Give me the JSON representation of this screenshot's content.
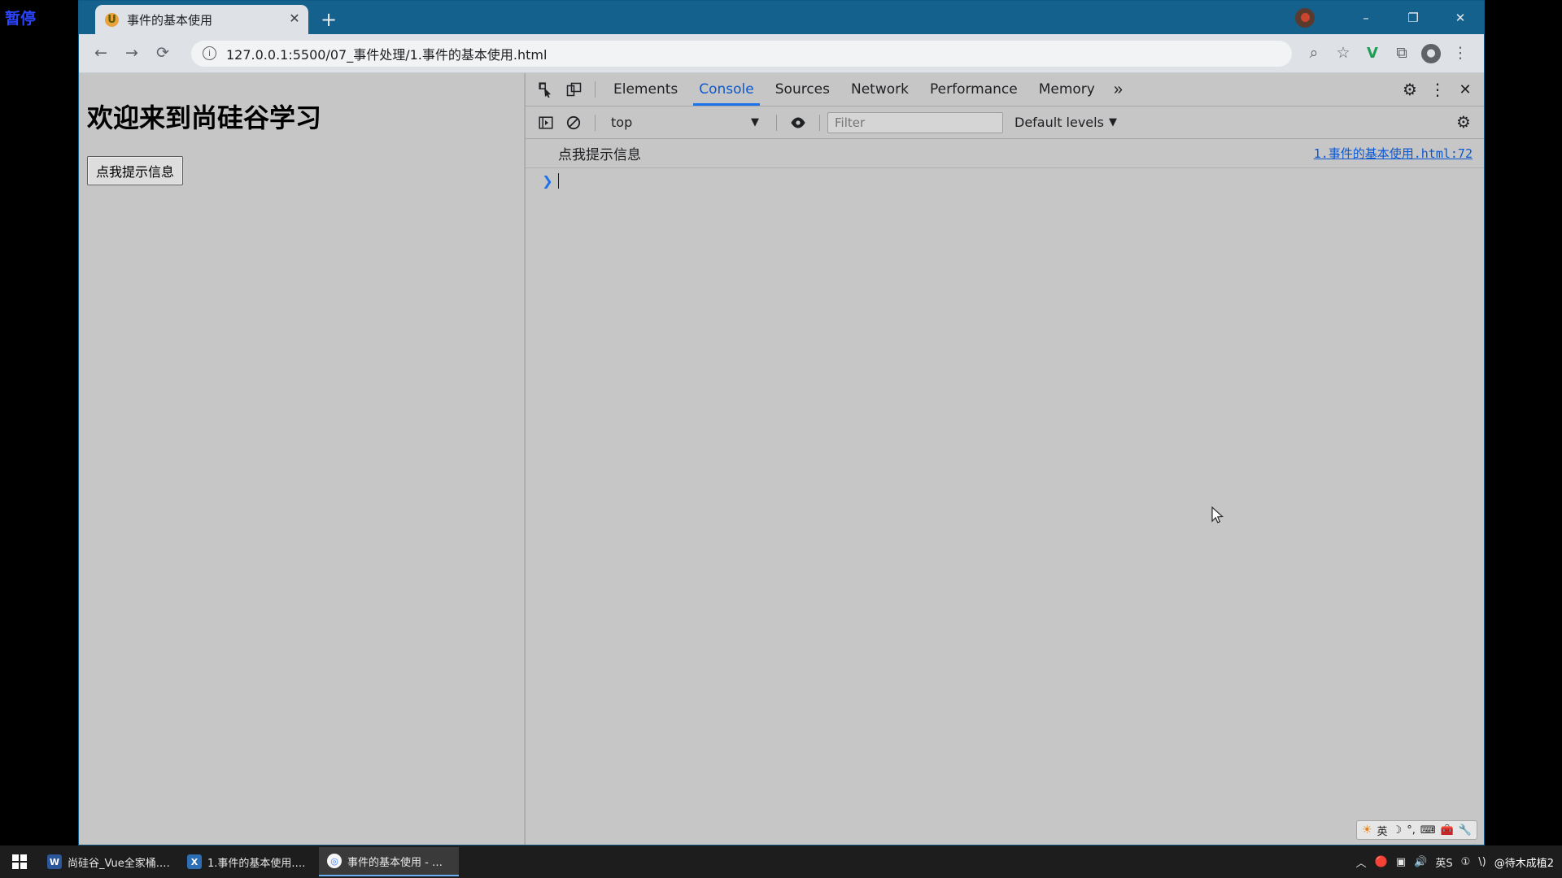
{
  "desktop": {
    "left_label": "暂停"
  },
  "browser": {
    "tab": {
      "title": "事件的基本使用",
      "favicon": "vue-favicon-icon",
      "close_label": "✕"
    },
    "new_tab_label": "+",
    "window_controls": {
      "minimize": "–",
      "maximize": "❐",
      "close": "✕"
    },
    "toolbar": {
      "back_label": "←",
      "forward_label": "→",
      "reload_label": "⟳",
      "url": "127.0.0.1:5500/07_事件处理/1.事件的基本使用.html",
      "info_label": "i",
      "zoom_label": "⌕",
      "bookmark_label": "☆",
      "ext_label": "V",
      "puzzle_label": "⧉",
      "avatar_label": "●",
      "menu_label": "⋮"
    }
  },
  "page": {
    "heading": "欢迎来到尚硅谷学习",
    "button_label": "点我提示信息"
  },
  "devtools": {
    "inspect_icon": "inspect-element-icon",
    "device_icon": "device-toolbar-icon",
    "tabs": [
      {
        "label": "Elements",
        "active": false
      },
      {
        "label": "Console",
        "active": true
      },
      {
        "label": "Sources",
        "active": false
      },
      {
        "label": "Network",
        "active": false
      },
      {
        "label": "Performance",
        "active": false
      },
      {
        "label": "Memory",
        "active": false
      }
    ],
    "more_tabs_label": "»",
    "settings_label": "⚙",
    "kebab_label": "⋮",
    "close_label": "✕",
    "console_toolbar": {
      "sidebar_label": "▶",
      "clear_label": "⊘",
      "context": "top",
      "context_caret": "▼",
      "eye_label": "◉",
      "filter_placeholder": "Filter",
      "filter_value": "",
      "levels_label": "Default levels",
      "levels_caret": "▼",
      "gear_label": "⚙"
    },
    "logs": [
      {
        "message": "点我提示信息",
        "source": "1.事件的基本使用.html:72"
      }
    ],
    "prompt": {
      "arrow": "❯",
      "value": ""
    },
    "ime_tray": {
      "logo": "搜狗输入法图标",
      "mode": "英",
      "moon": "☽",
      "punct": "°,",
      "keyboard": "⌨",
      "toolbox": "🧰",
      "wrench": "🔧"
    }
  },
  "taskbar": {
    "start_label": "start-icon",
    "items": [
      {
        "label": "尚硅谷_Vue全家桶.d...",
        "icon": "word-icon",
        "icon_text": "W",
        "active": false
      },
      {
        "label": "1.事件的基本使用.ht...",
        "icon": "vscode-icon",
        "icon_text": "X",
        "active": false
      },
      {
        "label": "事件的基本使用 - Go...",
        "icon": "chrome-icon",
        "icon_text": "◎",
        "active": true
      }
    ],
    "tray": {
      "chevron": "︿",
      "app1": "🔴",
      "app2": "▣",
      "speaker": "🔊",
      "ime": "英S",
      "ime2": "①",
      "network": "\\)",
      "user": "@待木成植2"
    }
  }
}
